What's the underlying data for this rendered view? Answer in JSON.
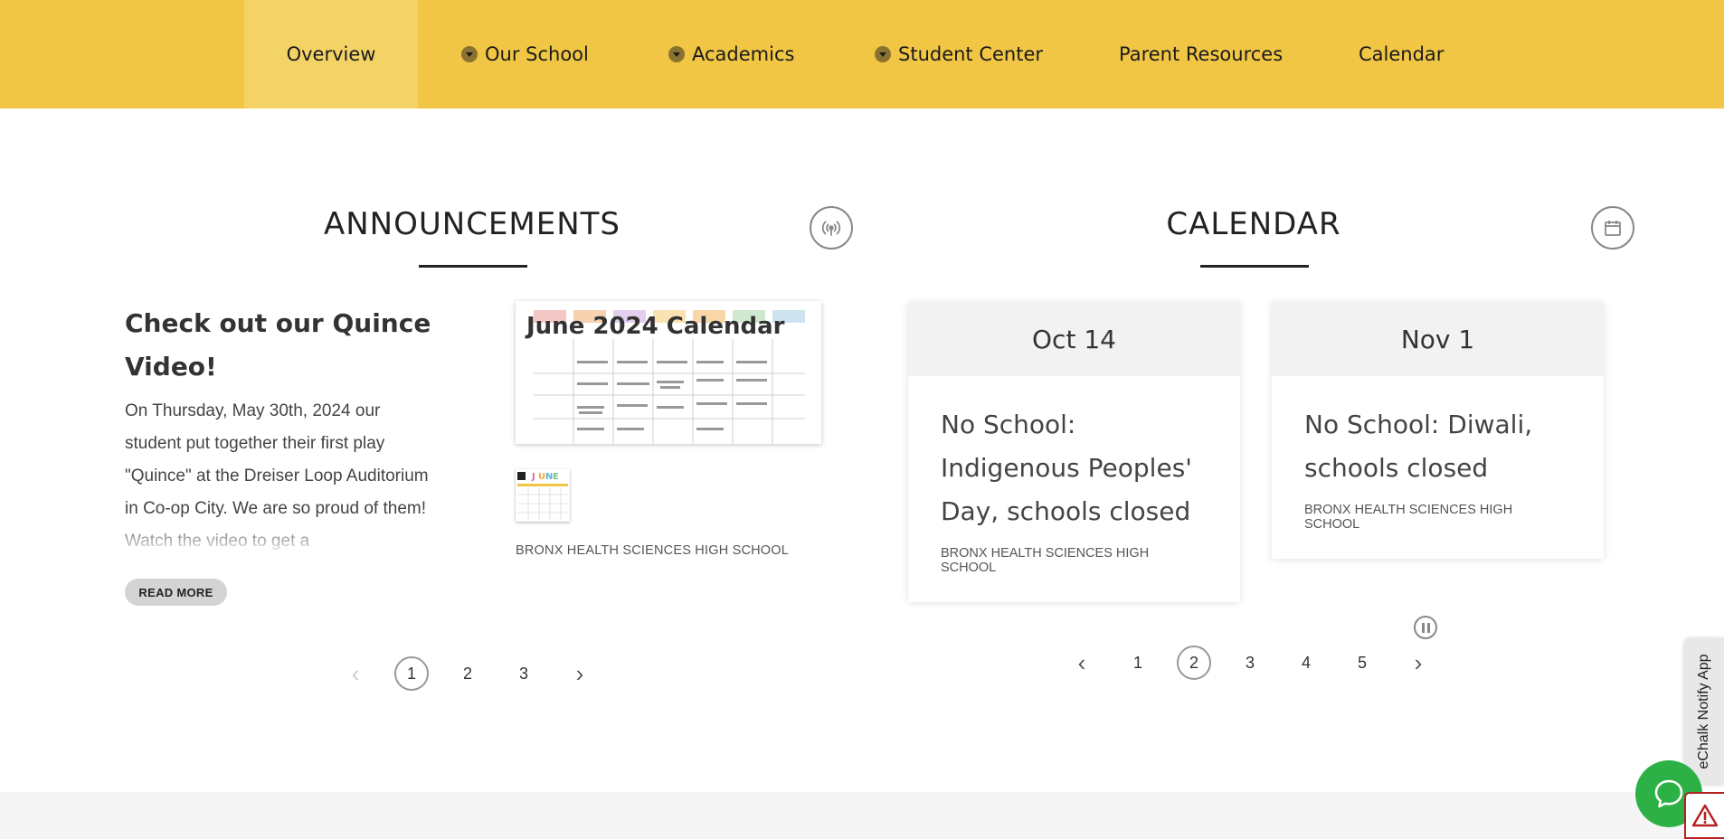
{
  "nav": {
    "items": [
      {
        "label": "Overview",
        "active": true,
        "has_dropdown": false
      },
      {
        "label": "Our School",
        "active": false,
        "has_dropdown": true
      },
      {
        "label": "Academics",
        "active": false,
        "has_dropdown": true
      },
      {
        "label": "Student Center",
        "active": false,
        "has_dropdown": true
      },
      {
        "label": "Parent Resources",
        "active": false,
        "has_dropdown": false
      },
      {
        "label": "Calendar",
        "active": false,
        "has_dropdown": false
      }
    ],
    "bg_color": "#f1c644",
    "active_color": "#f3d266"
  },
  "announcements": {
    "title": "ANNOUNCEMENTS",
    "icon": "broadcast-icon",
    "item": {
      "title": "Check out our Quince Video!",
      "body": "On Thursday, May 30th, 2024 our student put together their first play \"Quince\" at the Dreiser Loop Auditorium in Co-op City. We are so proud of them! Watch the video to get a",
      "read_more": "READ MORE",
      "image_heading": "June 2024 Calendar",
      "school": "BRONX HEALTH SCIENCES HIGH SCHOOL"
    },
    "pager": {
      "pages": [
        "1",
        "2",
        "3"
      ],
      "current": "1",
      "prev": "‹",
      "next": "›"
    }
  },
  "calendar": {
    "title": "CALENDAR",
    "icon": "calendar-icon",
    "events": [
      {
        "date": "Oct 14",
        "title": "No School: Indigenous Peoples' Day, schools closed",
        "school": "BRONX HEALTH SCIENCES HIGH SCHOOL"
      },
      {
        "date": "Nov 1",
        "title": "No School: Diwali, schools closed",
        "school": "BRONX HEALTH SCIENCES HIGH SCHOOL"
      }
    ],
    "pager": {
      "pages": [
        "1",
        "2",
        "3",
        "4",
        "5"
      ],
      "current": "2",
      "prev": "‹",
      "next": "›"
    }
  },
  "widgets": {
    "echalk_label": "eChalk Notify App",
    "chat_color": "#2db045",
    "warn_color": "#b52020"
  }
}
